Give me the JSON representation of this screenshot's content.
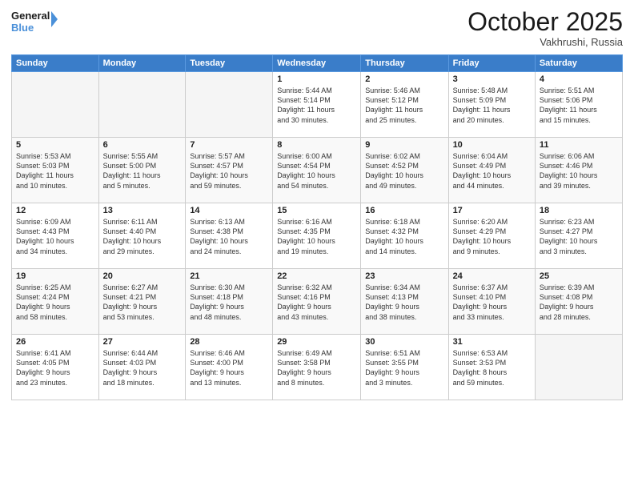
{
  "header": {
    "logo_line1": "General",
    "logo_line2": "Blue",
    "month": "October 2025",
    "location": "Vakhrushi, Russia"
  },
  "weekdays": [
    "Sunday",
    "Monday",
    "Tuesday",
    "Wednesday",
    "Thursday",
    "Friday",
    "Saturday"
  ],
  "weeks": [
    [
      {
        "day": "",
        "info": ""
      },
      {
        "day": "",
        "info": ""
      },
      {
        "day": "",
        "info": ""
      },
      {
        "day": "1",
        "info": "Sunrise: 5:44 AM\nSunset: 5:14 PM\nDaylight: 11 hours\nand 30 minutes."
      },
      {
        "day": "2",
        "info": "Sunrise: 5:46 AM\nSunset: 5:12 PM\nDaylight: 11 hours\nand 25 minutes."
      },
      {
        "day": "3",
        "info": "Sunrise: 5:48 AM\nSunset: 5:09 PM\nDaylight: 11 hours\nand 20 minutes."
      },
      {
        "day": "4",
        "info": "Sunrise: 5:51 AM\nSunset: 5:06 PM\nDaylight: 11 hours\nand 15 minutes."
      }
    ],
    [
      {
        "day": "5",
        "info": "Sunrise: 5:53 AM\nSunset: 5:03 PM\nDaylight: 11 hours\nand 10 minutes."
      },
      {
        "day": "6",
        "info": "Sunrise: 5:55 AM\nSunset: 5:00 PM\nDaylight: 11 hours\nand 5 minutes."
      },
      {
        "day": "7",
        "info": "Sunrise: 5:57 AM\nSunset: 4:57 PM\nDaylight: 10 hours\nand 59 minutes."
      },
      {
        "day": "8",
        "info": "Sunrise: 6:00 AM\nSunset: 4:54 PM\nDaylight: 10 hours\nand 54 minutes."
      },
      {
        "day": "9",
        "info": "Sunrise: 6:02 AM\nSunset: 4:52 PM\nDaylight: 10 hours\nand 49 minutes."
      },
      {
        "day": "10",
        "info": "Sunrise: 6:04 AM\nSunset: 4:49 PM\nDaylight: 10 hours\nand 44 minutes."
      },
      {
        "day": "11",
        "info": "Sunrise: 6:06 AM\nSunset: 4:46 PM\nDaylight: 10 hours\nand 39 minutes."
      }
    ],
    [
      {
        "day": "12",
        "info": "Sunrise: 6:09 AM\nSunset: 4:43 PM\nDaylight: 10 hours\nand 34 minutes."
      },
      {
        "day": "13",
        "info": "Sunrise: 6:11 AM\nSunset: 4:40 PM\nDaylight: 10 hours\nand 29 minutes."
      },
      {
        "day": "14",
        "info": "Sunrise: 6:13 AM\nSunset: 4:38 PM\nDaylight: 10 hours\nand 24 minutes."
      },
      {
        "day": "15",
        "info": "Sunrise: 6:16 AM\nSunset: 4:35 PM\nDaylight: 10 hours\nand 19 minutes."
      },
      {
        "day": "16",
        "info": "Sunrise: 6:18 AM\nSunset: 4:32 PM\nDaylight: 10 hours\nand 14 minutes."
      },
      {
        "day": "17",
        "info": "Sunrise: 6:20 AM\nSunset: 4:29 PM\nDaylight: 10 hours\nand 9 minutes."
      },
      {
        "day": "18",
        "info": "Sunrise: 6:23 AM\nSunset: 4:27 PM\nDaylight: 10 hours\nand 3 minutes."
      }
    ],
    [
      {
        "day": "19",
        "info": "Sunrise: 6:25 AM\nSunset: 4:24 PM\nDaylight: 9 hours\nand 58 minutes."
      },
      {
        "day": "20",
        "info": "Sunrise: 6:27 AM\nSunset: 4:21 PM\nDaylight: 9 hours\nand 53 minutes."
      },
      {
        "day": "21",
        "info": "Sunrise: 6:30 AM\nSunset: 4:18 PM\nDaylight: 9 hours\nand 48 minutes."
      },
      {
        "day": "22",
        "info": "Sunrise: 6:32 AM\nSunset: 4:16 PM\nDaylight: 9 hours\nand 43 minutes."
      },
      {
        "day": "23",
        "info": "Sunrise: 6:34 AM\nSunset: 4:13 PM\nDaylight: 9 hours\nand 38 minutes."
      },
      {
        "day": "24",
        "info": "Sunrise: 6:37 AM\nSunset: 4:10 PM\nDaylight: 9 hours\nand 33 minutes."
      },
      {
        "day": "25",
        "info": "Sunrise: 6:39 AM\nSunset: 4:08 PM\nDaylight: 9 hours\nand 28 minutes."
      }
    ],
    [
      {
        "day": "26",
        "info": "Sunrise: 6:41 AM\nSunset: 4:05 PM\nDaylight: 9 hours\nand 23 minutes."
      },
      {
        "day": "27",
        "info": "Sunrise: 6:44 AM\nSunset: 4:03 PM\nDaylight: 9 hours\nand 18 minutes."
      },
      {
        "day": "28",
        "info": "Sunrise: 6:46 AM\nSunset: 4:00 PM\nDaylight: 9 hours\nand 13 minutes."
      },
      {
        "day": "29",
        "info": "Sunrise: 6:49 AM\nSunset: 3:58 PM\nDaylight: 9 hours\nand 8 minutes."
      },
      {
        "day": "30",
        "info": "Sunrise: 6:51 AM\nSunset: 3:55 PM\nDaylight: 9 hours\nand 3 minutes."
      },
      {
        "day": "31",
        "info": "Sunrise: 6:53 AM\nSunset: 3:53 PM\nDaylight: 8 hours\nand 59 minutes."
      },
      {
        "day": "",
        "info": ""
      }
    ]
  ]
}
